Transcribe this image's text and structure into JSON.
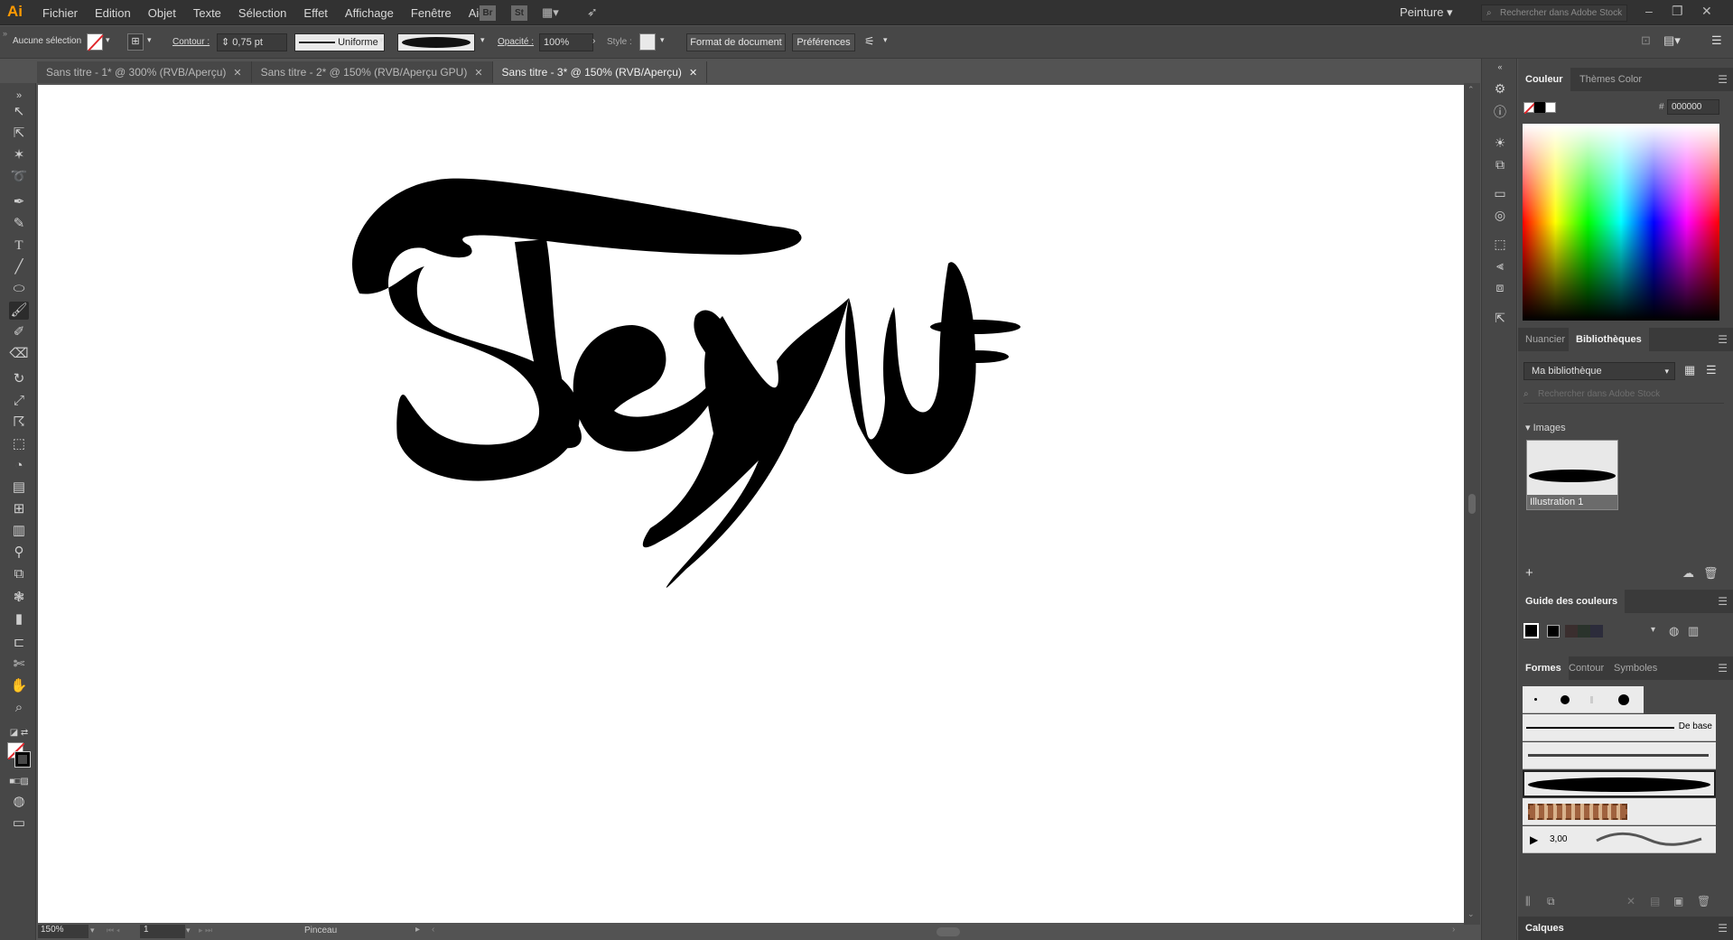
{
  "app": {
    "logo": "Ai",
    "menus": [
      "Fichier",
      "Edition",
      "Objet",
      "Texte",
      "Sélection",
      "Effet",
      "Affichage",
      "Fenêtre",
      "Aide"
    ],
    "bridge_label": "Br",
    "stock_label": "St",
    "workspace": "Peinture",
    "stock_search_placeholder": "Rechercher dans Adobe Stock"
  },
  "control_bar": {
    "selection_label": "Aucune sélection",
    "stroke_label": "Contour :",
    "stroke_value": "0,75 pt",
    "profile_label": "Uniforme",
    "opacity_label": "Opacité :",
    "opacity_value": "100%",
    "style_label": "Style :",
    "doc_format_button": "Format de document",
    "prefs_button": "Préférences"
  },
  "tabs": [
    {
      "label": "Sans titre - 1* @ 300% (RVB/Aperçu)",
      "active": false
    },
    {
      "label": "Sans titre - 2* @ 150% (RVB/Aperçu GPU)",
      "active": false
    },
    {
      "label": "Sans titre - 3* @ 150% (RVB/Aperçu)",
      "active": true
    }
  ],
  "status": {
    "zoom": "150%",
    "artboard_number": "1",
    "tool_name": "Pinceau"
  },
  "color_panel": {
    "tab_color": "Couleur",
    "tab_themes": "Thèmes Color",
    "hex_prefix": "#",
    "hex_value": "000000"
  },
  "libraries_panel": {
    "tab_swatches": "Nuancier",
    "tab_libraries": "Bibliothèques",
    "library_name": "Ma bibliothèque",
    "search_placeholder": "Rechercher dans Adobe Stock",
    "section_title": "Images",
    "item_label": "Illustration 1"
  },
  "color_guide": {
    "title": "Guide des couleurs"
  },
  "brushes_panel": {
    "tab_brushes": "Formes",
    "tab_stroke": "Contour",
    "tab_symbols": "Symboles",
    "basic_label": "De base",
    "size_value": "3,00"
  },
  "layers_panel": {
    "title": "Calques"
  },
  "colors": {
    "ui_dark": "#323232",
    "ui_mid": "#474747",
    "ui_bg": "#535353",
    "accent_logo": "#ff9a00"
  }
}
